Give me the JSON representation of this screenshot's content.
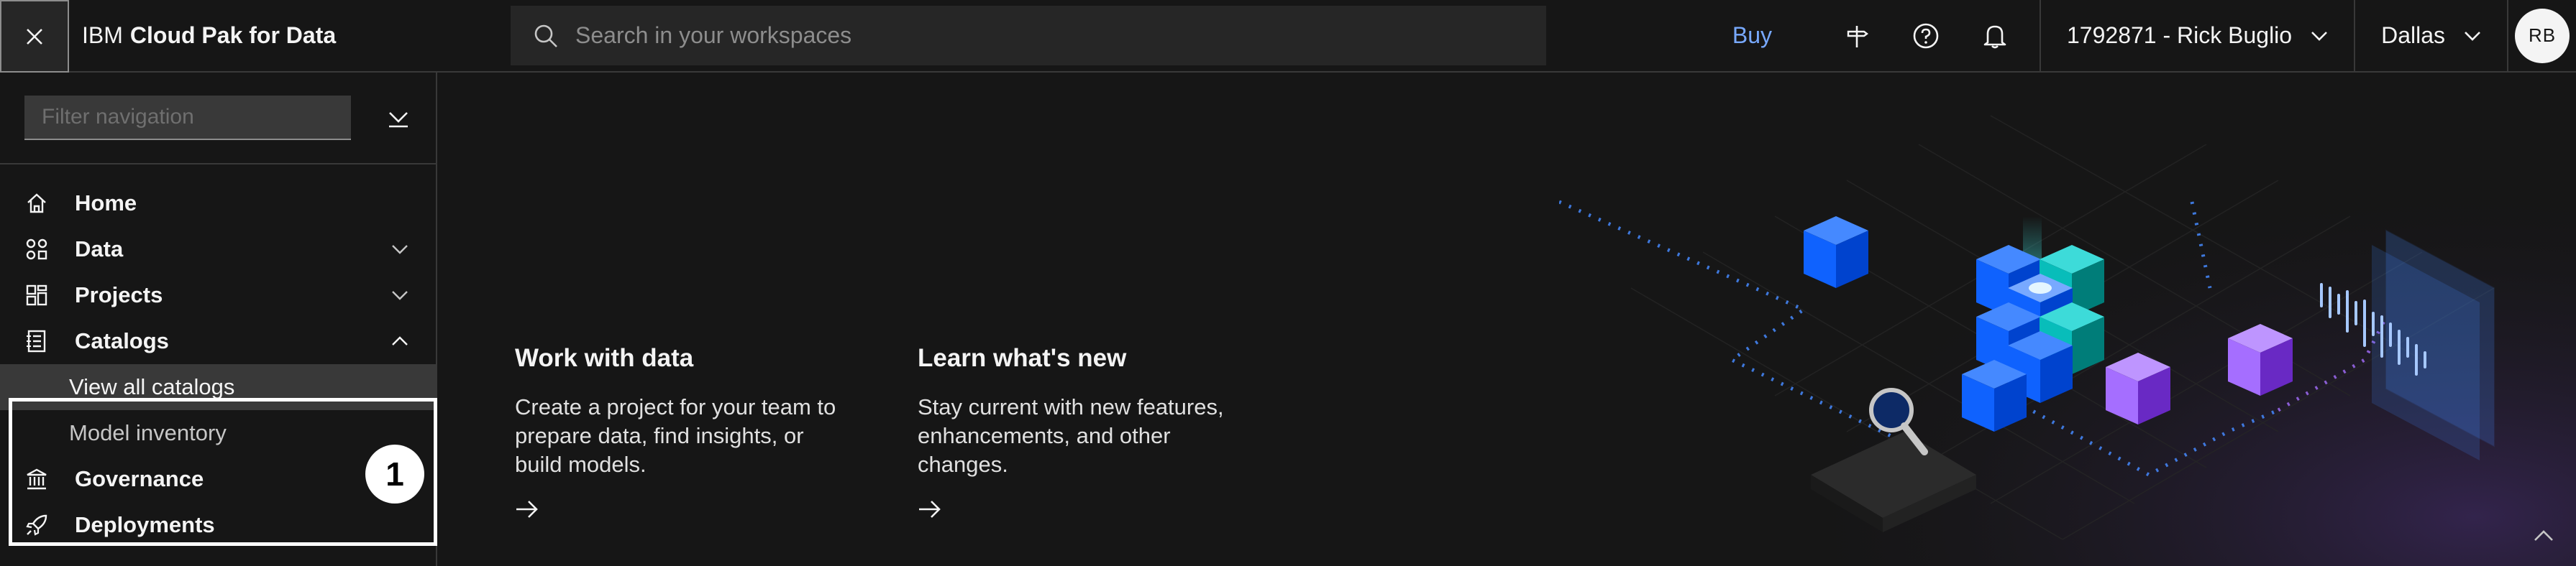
{
  "header": {
    "brand_prefix": "IBM",
    "brand_name": "Cloud Pak for Data",
    "search_placeholder": "Search in your workspaces",
    "buy_label": "Buy",
    "account_label": "1792871 - Rick Buglio",
    "region_label": "Dallas",
    "avatar_initials": "RB"
  },
  "sidebar": {
    "filter_placeholder": "Filter navigation",
    "items": [
      {
        "label": "Home",
        "icon": "home-icon",
        "expandable": false
      },
      {
        "label": "Data",
        "icon": "data-icon",
        "expandable": true
      },
      {
        "label": "Projects",
        "icon": "projects-icon",
        "expandable": true
      },
      {
        "label": "Catalogs",
        "icon": "catalog-icon",
        "expandable": true,
        "expanded": true,
        "children": [
          {
            "label": "View all catalogs",
            "selected": true
          },
          {
            "label": "Model inventory",
            "selected": false
          }
        ]
      },
      {
        "label": "Governance",
        "icon": "governance-icon",
        "expandable": true
      },
      {
        "label": "Deployments",
        "icon": "rocket-icon",
        "expandable": false
      }
    ],
    "callout_number": "1"
  },
  "main": {
    "cards": [
      {
        "title": "Work with data",
        "body": "Create a project for your team to prepare data, find insights, or build models."
      },
      {
        "title": "Learn what's new",
        "body": "Stay current with new features, enhancements, and other changes."
      }
    ]
  },
  "colors": {
    "background": "#161616",
    "link": "#78a9ff",
    "cube_blue": "#0f62fe",
    "cube_teal": "#08bdba",
    "cube_purple": "#a56eff"
  }
}
